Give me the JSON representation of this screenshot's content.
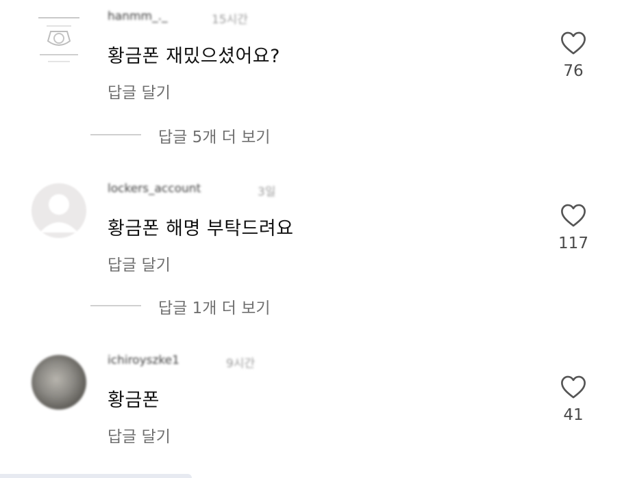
{
  "comments": [
    {
      "username": "hanmm_._",
      "time": "15시간",
      "text": "황금폰 재밌으셨어요?",
      "reply_label": "답글 달기",
      "likes": "76",
      "more_replies": "답글 5개 더 보기"
    },
    {
      "username": "lockers_account",
      "time": "3일",
      "text": "황금폰 해명 부탁드려요",
      "reply_label": "답글 달기",
      "likes": "117",
      "more_replies": "답글 1개 더 보기"
    },
    {
      "username": "ichiroyszke1",
      "time": "9시간",
      "text": "황금폰",
      "reply_label": "답글 달기",
      "likes": "41"
    }
  ],
  "icons": {
    "like": "heart-outline-icon",
    "avatar_default": "default-avatar-icon"
  },
  "colors": {
    "text_primary": "#111111",
    "text_secondary": "#6f6f6f",
    "heart_stroke": "#555555"
  }
}
